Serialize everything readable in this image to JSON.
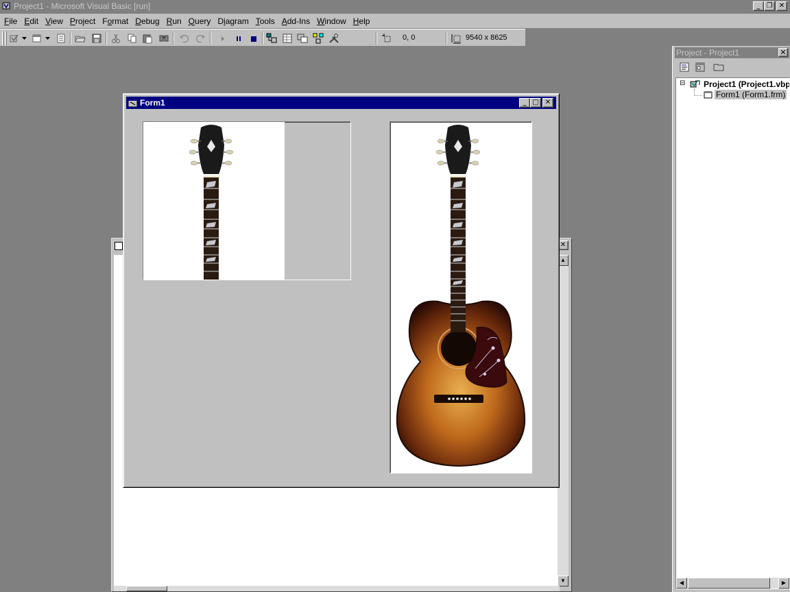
{
  "app": {
    "title": "Project1 - Microsoft Visual Basic [run]",
    "caption_buttons": {
      "minimize": "_",
      "restore": "❐",
      "close": "✕"
    }
  },
  "menu": [
    {
      "label": "File",
      "mnemonic": "F",
      "rest": "ile"
    },
    {
      "label": "Edit",
      "mnemonic": "E",
      "rest": "dit"
    },
    {
      "label": "View",
      "mnemonic": "V",
      "rest": "iew"
    },
    {
      "label": "Project",
      "mnemonic": "P",
      "rest": "roject"
    },
    {
      "label": "Format",
      "pre": "F",
      "mnemonic": "o",
      "rest": "rmat"
    },
    {
      "label": "Debug",
      "mnemonic": "D",
      "rest": "ebug"
    },
    {
      "label": "Run",
      "mnemonic": "R",
      "rest": "un"
    },
    {
      "label": "Query",
      "mnemonic": "Q",
      "rest": "uery"
    },
    {
      "label": "Diagram",
      "pre": "D",
      "mnemonic": "i",
      "rest": "agram"
    },
    {
      "label": "Tools",
      "mnemonic": "T",
      "rest": "ools"
    },
    {
      "label": "Add-Ins",
      "mnemonic": "A",
      "rest": "dd-Ins"
    },
    {
      "label": "Window",
      "mnemonic": "W",
      "rest": "indow"
    },
    {
      "label": "Help",
      "mnemonic": "H",
      "rest": "elp"
    }
  ],
  "toolbar": {
    "position_readout": "0, 0",
    "size_readout": "9540 x 8625"
  },
  "form1": {
    "title": "Form1",
    "caption_buttons": {
      "minimize": "_",
      "maximize": "□",
      "close": "✕"
    }
  },
  "code_window": {
    "close": "✕",
    "scroll_up": "▲",
    "scroll_down": "▼"
  },
  "project_explorer": {
    "title": "Project - Project1",
    "close": "✕",
    "tree": {
      "project_expander": "⊟",
      "project": "Project1 (Project1.vbp)",
      "form": "Form1 (Form1.frm)"
    },
    "scroll_left": "◀",
    "scroll_right": "▶"
  },
  "colors": {
    "desktop": "#808080",
    "face": "#c0c0c0",
    "active_title": "#000080",
    "guitar_body": "#7a3510",
    "fretboard": "#2a1a10"
  }
}
